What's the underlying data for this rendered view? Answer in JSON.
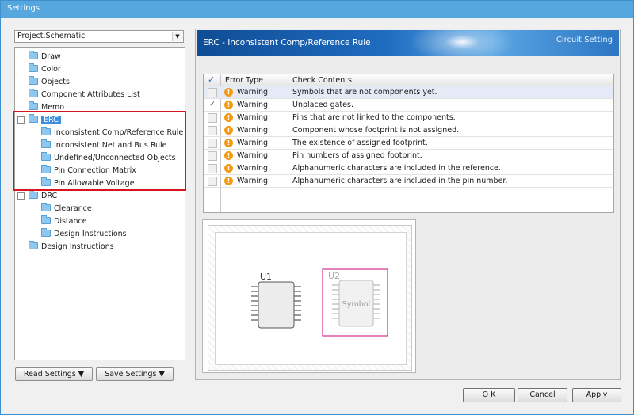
{
  "window": {
    "title": "Settings"
  },
  "project_select": {
    "value": "Project.Schematic",
    "arrow": "▼"
  },
  "tree": {
    "items": [
      {
        "label": "Draw"
      },
      {
        "label": "Color"
      },
      {
        "label": "Objects"
      },
      {
        "label": "Component Attributes List"
      },
      {
        "label": "Memo"
      },
      {
        "label": "ERC",
        "expander": "−"
      },
      {
        "label": "Inconsistent Comp/Reference Rule"
      },
      {
        "label": "Inconsistent Net and Bus Rule"
      },
      {
        "label": "Undefined/Unconnected Objects"
      },
      {
        "label": "Pin Connection Matrix"
      },
      {
        "label": "Pin Allowable Voltage"
      },
      {
        "label": "DRC",
        "expander": "−"
      },
      {
        "label": "Clearance"
      },
      {
        "label": "Distance"
      },
      {
        "label": "Design Instructions"
      },
      {
        "label": "Design Instructions"
      }
    ]
  },
  "left_buttons": {
    "read": "Read Settings ▼",
    "save": "Save Settings ▼"
  },
  "banner": {
    "title": "ERC - Inconsistent Comp/Reference Rule",
    "subtitle": "Circuit Setting"
  },
  "table": {
    "header_check": "✓",
    "columns": [
      "Error Type",
      "Check Contents"
    ],
    "rows": [
      {
        "checked": "",
        "type": "Warning",
        "content": "Symbols that are not components yet."
      },
      {
        "checked": "✓",
        "type": "Warning",
        "content": "Unplaced gates."
      },
      {
        "checked": "",
        "type": "Warning",
        "content": "Pins that are not linked to the components."
      },
      {
        "checked": "",
        "type": "Warning",
        "content": "Component whose footprint is not assigned."
      },
      {
        "checked": "",
        "type": "Warning",
        "content": "The existence of assigned footprint."
      },
      {
        "checked": "",
        "type": "Warning",
        "content": "Pin numbers of assigned footprint."
      },
      {
        "checked": "",
        "type": "Warning",
        "content": "Alphanumeric characters are included in the reference."
      },
      {
        "checked": "",
        "type": "Warning",
        "content": "Alphanumeric characters are included in the pin number."
      }
    ],
    "warn_icon": "!"
  },
  "preview": {
    "u1": "U1",
    "u2": "U2",
    "symbol": "Symbol",
    "u2_color": "#d2308a"
  },
  "buttons": {
    "ok": "O K",
    "cancel": "Cancel",
    "apply": "Apply"
  }
}
